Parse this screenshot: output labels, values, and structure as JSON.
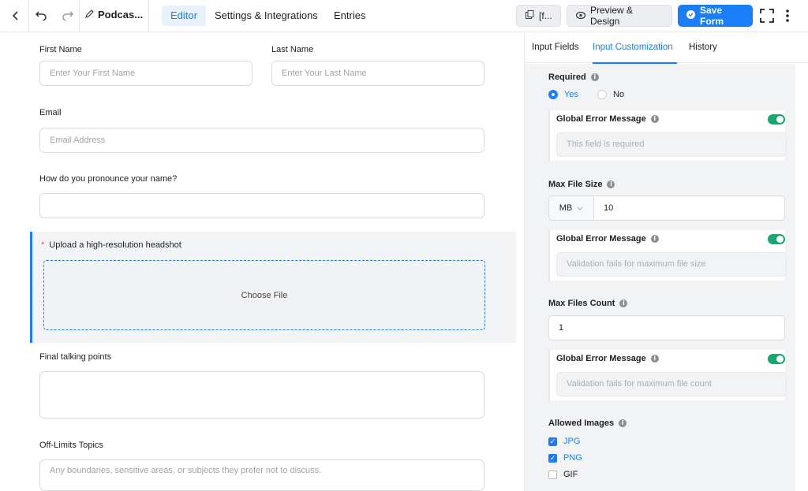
{
  "topbar": {
    "form_title": "Podcas...",
    "tabs": [
      "Editor",
      "Settings & Integrations",
      "Entries"
    ],
    "shortcode_label": "[f...",
    "preview_label": "Preview & Design",
    "save_label": "Save Form"
  },
  "form": {
    "first_name": {
      "label": "First Name",
      "placeholder": "Enter Your First Name"
    },
    "last_name": {
      "label": "Last Name",
      "placeholder": "Enter Your Last Name"
    },
    "email": {
      "label": "Email",
      "placeholder": "Email Address"
    },
    "pronounce": {
      "label": "How do you pronounce your name?",
      "placeholder": ""
    },
    "upload": {
      "required_mark": "*",
      "label": "Upload a high-resolution headshot",
      "button": "Choose File"
    },
    "talking_points": {
      "label": "Final talking points",
      "placeholder": ""
    },
    "off_limits": {
      "label": "Off-Limits Topics",
      "placeholder": "Any boundaries, sensitive areas, or subjects they prefer not to discuss."
    }
  },
  "panel": {
    "tabs": [
      "Input Fields",
      "Input Customization",
      "History"
    ],
    "required": {
      "label": "Required",
      "yes": "Yes",
      "no": "No",
      "selected": "Yes"
    },
    "error1": {
      "label": "Global Error Message",
      "placeholder": "This field is required",
      "enabled": true
    },
    "max_file_size": {
      "label": "Max File Size",
      "unit": "MB",
      "value": "10"
    },
    "error2": {
      "label": "Global Error Message",
      "placeholder": "Validation fails for maximum file size",
      "enabled": true
    },
    "max_files_count": {
      "label": "Max Files Count",
      "value": "1"
    },
    "error3": {
      "label": "Global Error Message",
      "placeholder": "Validation fails for maximum file count",
      "enabled": true
    },
    "allowed_images": {
      "label": "Allowed Images",
      "options": [
        {
          "label": "JPG",
          "checked": true
        },
        {
          "label": "PNG",
          "checked": true
        },
        {
          "label": "GIF",
          "checked": false
        }
      ]
    }
  },
  "colors": {
    "accent": "#1a7efb",
    "toggle_on": "#13a970"
  },
  "icons": [
    "back-icon",
    "undo-icon",
    "redo-icon",
    "pencil-icon",
    "copy-icon",
    "eye-icon",
    "check-circle-icon",
    "fullscreen-icon",
    "more-vert-icon",
    "info-icon",
    "chevron-down-icon"
  ]
}
